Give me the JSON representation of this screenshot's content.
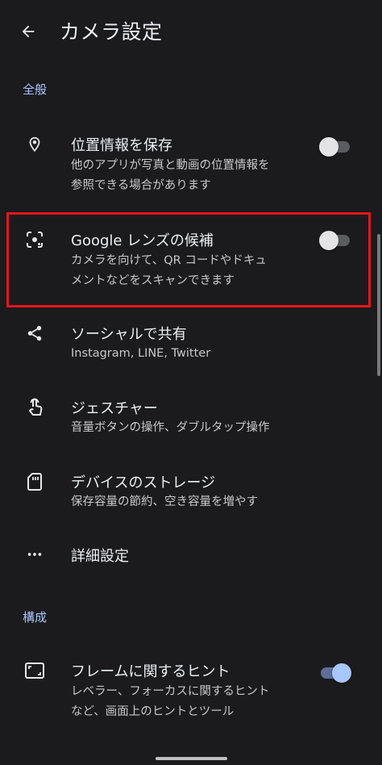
{
  "header": {
    "title": "カメラ設定",
    "back_icon": "arrow-back-icon"
  },
  "sections": {
    "general": "全般",
    "composition": "構成"
  },
  "items": [
    {
      "label": "位置情報を保存",
      "summary_1": "他のアプリが写真と動画の位置情報を",
      "summary_2": "参照できる場合があります",
      "icon": "location-pin-icon",
      "toggle": false
    },
    {
      "label": "Google レンズの候補",
      "summary_1": "カメラを向けて、QR コードやドキュ",
      "summary_2": "メントなどをスキャンできます",
      "icon": "lens-icon",
      "toggle": false
    },
    {
      "label": "ソーシャルで共有",
      "summary_1": "Instagram, LINE, Twitter",
      "icon": "share-icon"
    },
    {
      "label": "ジェスチャー",
      "summary_1": "音量ボタンの操作、ダブルタップ操作",
      "icon": "gesture-icon"
    },
    {
      "label": "デバイスのストレージ",
      "summary_1": "保存容量の節約、空き容量を増やす",
      "icon": "sd-card-icon"
    },
    {
      "label": "詳細設定",
      "icon": "more-horiz-icon"
    },
    {
      "label": "フレームに関するヒント",
      "summary_1": "レベラー、フォーカスに関するヒント",
      "summary_2": "など、画面上のヒントとツール",
      "icon": "frame-icon",
      "toggle": true
    }
  ],
  "colors": {
    "background": "#1b1b1d",
    "accent": "#a8c7fa",
    "highlight_border": "#e5161b"
  }
}
